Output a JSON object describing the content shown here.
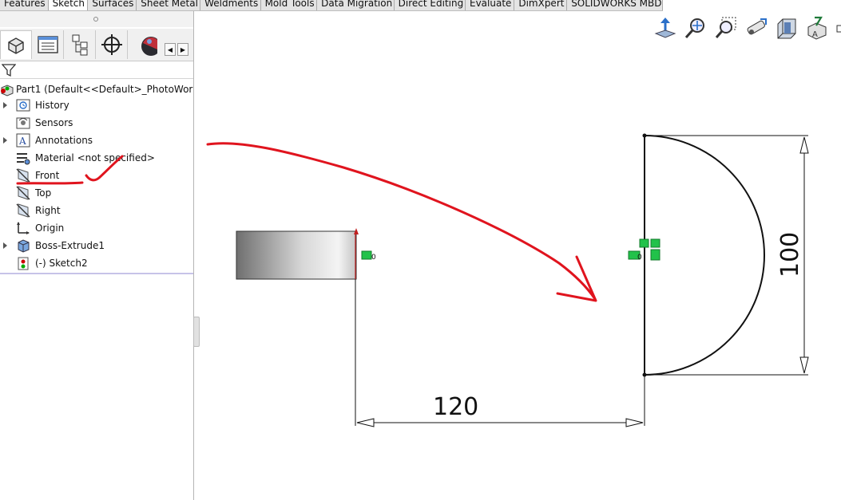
{
  "command_tabs": [
    "Features",
    "Sketch",
    "Surfaces",
    "Sheet Metal",
    "Weldments",
    "Mold Tools",
    "Data Migration",
    "Direct Editing",
    "Evaluate",
    "DimXpert",
    "SOLIDWORKS MBD"
  ],
  "active_tab": "Sketch",
  "feature_tree": {
    "root": "Part1  (Default<<Default>_PhotoWork",
    "items": [
      {
        "label": "History",
        "icon": "history-icon",
        "expandable": true
      },
      {
        "label": "Sensors",
        "icon": "sensors-icon",
        "expandable": false
      },
      {
        "label": "Annotations",
        "icon": "annotations-icon",
        "expandable": true
      },
      {
        "label": "Material <not specified>",
        "icon": "material-icon",
        "expandable": false
      },
      {
        "label": "Front",
        "icon": "plane-icon",
        "expandable": false
      },
      {
        "label": "Top",
        "icon": "plane-icon",
        "expandable": false
      },
      {
        "label": "Right",
        "icon": "plane-icon",
        "expandable": false
      },
      {
        "label": "Origin",
        "icon": "origin-icon",
        "expandable": false
      },
      {
        "label": "Boss-Extrude1",
        "icon": "boss-extrude-icon",
        "expandable": true
      },
      {
        "label": "(-) Sketch2",
        "icon": "sketch-icon",
        "expandable": false
      }
    ]
  },
  "dimensions": {
    "horizontal": "120",
    "vertical": "100"
  },
  "colors": {
    "annotation_red": "#e0141e",
    "relation_green": "#22c24a",
    "sketch_line": "#111111"
  }
}
